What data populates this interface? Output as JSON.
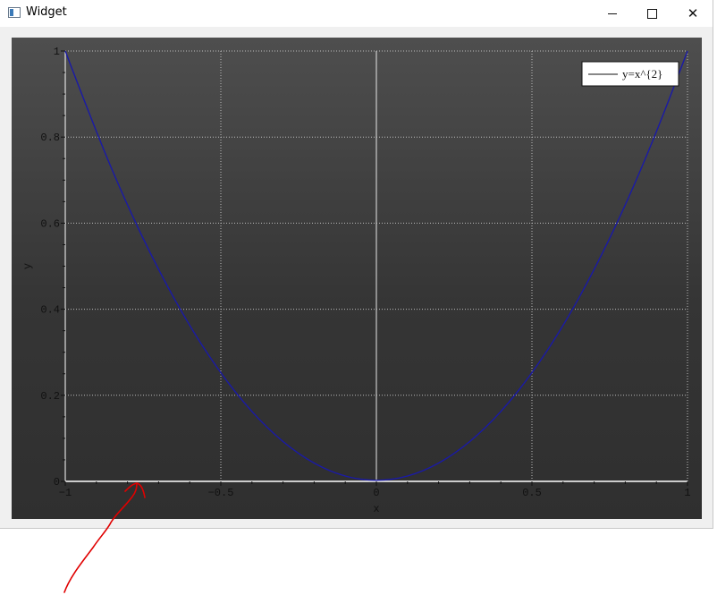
{
  "window": {
    "title": "Widget",
    "icon": "app-window-icon"
  },
  "titlebar_buttons": {
    "minimize": "minimize-icon",
    "maximize": "maximize-icon",
    "close": "close-icon"
  },
  "chart_data": {
    "type": "line",
    "title": "",
    "xlabel": "x",
    "ylabel": "y",
    "xlim": [
      -1,
      1
    ],
    "ylim": [
      0,
      1
    ],
    "x_ticks": [
      "−1",
      "−0.5",
      "0",
      "0.5",
      "1"
    ],
    "x_tick_values": [
      -1,
      -0.5,
      0,
      0.5,
      1
    ],
    "y_ticks": [
      "0",
      "0.2",
      "0.4",
      "0.6",
      "0.8",
      "1"
    ],
    "y_tick_values": [
      0,
      0.2,
      0.4,
      0.6,
      0.8,
      1
    ],
    "grid": true,
    "legend_position": "top-right",
    "series": [
      {
        "name": "y=x^{2}",
        "color": "#1a1aa6",
        "x": [
          -1,
          -0.9,
          -0.8,
          -0.7,
          -0.6,
          -0.5,
          -0.4,
          -0.3,
          -0.2,
          -0.1,
          0,
          0.1,
          0.2,
          0.3,
          0.4,
          0.5,
          0.6,
          0.7,
          0.8,
          0.9,
          1
        ],
        "y": [
          1,
          0.81,
          0.64,
          0.49,
          0.36,
          0.25,
          0.16,
          0.09,
          0.04,
          0.01,
          0,
          0.01,
          0.04,
          0.09,
          0.16,
          0.25,
          0.36,
          0.49,
          0.64,
          0.81,
          1
        ]
      }
    ],
    "legend_entries": [
      "y=x^{2}"
    ]
  },
  "colors": {
    "grid": "#bdbdbd",
    "zero_line": "#e6e6e6",
    "axis": "#ffffff",
    "annotation_arrow": "#e00000"
  }
}
